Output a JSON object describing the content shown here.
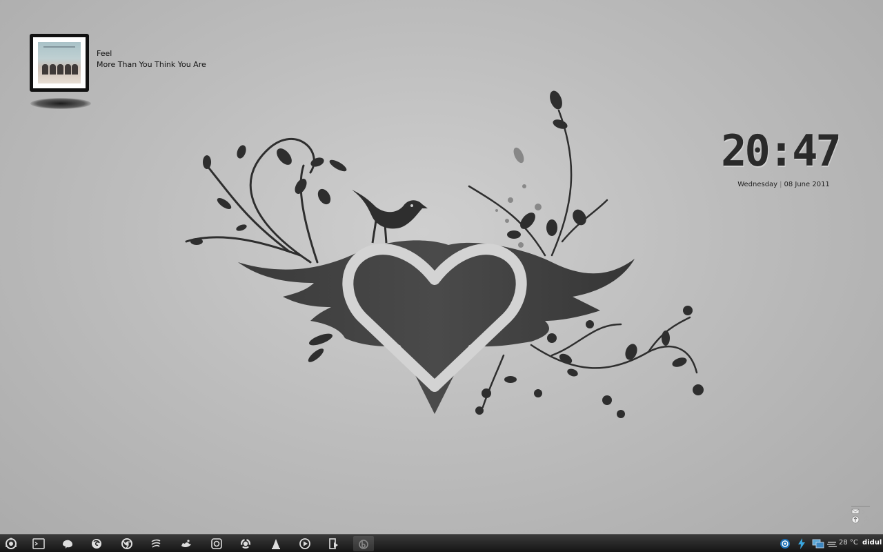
{
  "now_playing": {
    "artist": "Feel",
    "title": "More Than You Think You Are"
  },
  "clock": {
    "time": "20:47",
    "weekday": "Wednesday",
    "separator": "|",
    "date": "08 June 2011"
  },
  "taskbar": {
    "launchers": [
      "menu-icon",
      "terminal-icon",
      "pidgin-icon",
      "firefox-icon",
      "chrome-icon",
      "screenlets-icon",
      "gimp-icon",
      "screenshot-icon",
      "ubuntu-icon",
      "vlc-icon",
      "media-player-icon",
      "audio-player-icon",
      "bittorrent-icon"
    ],
    "tray": {
      "temperature": "28 °C",
      "user": "didul"
    }
  },
  "colors": {
    "taskbar": "#1e1e1e",
    "art": "#3c3c3c",
    "background": "#c4c4c4"
  }
}
